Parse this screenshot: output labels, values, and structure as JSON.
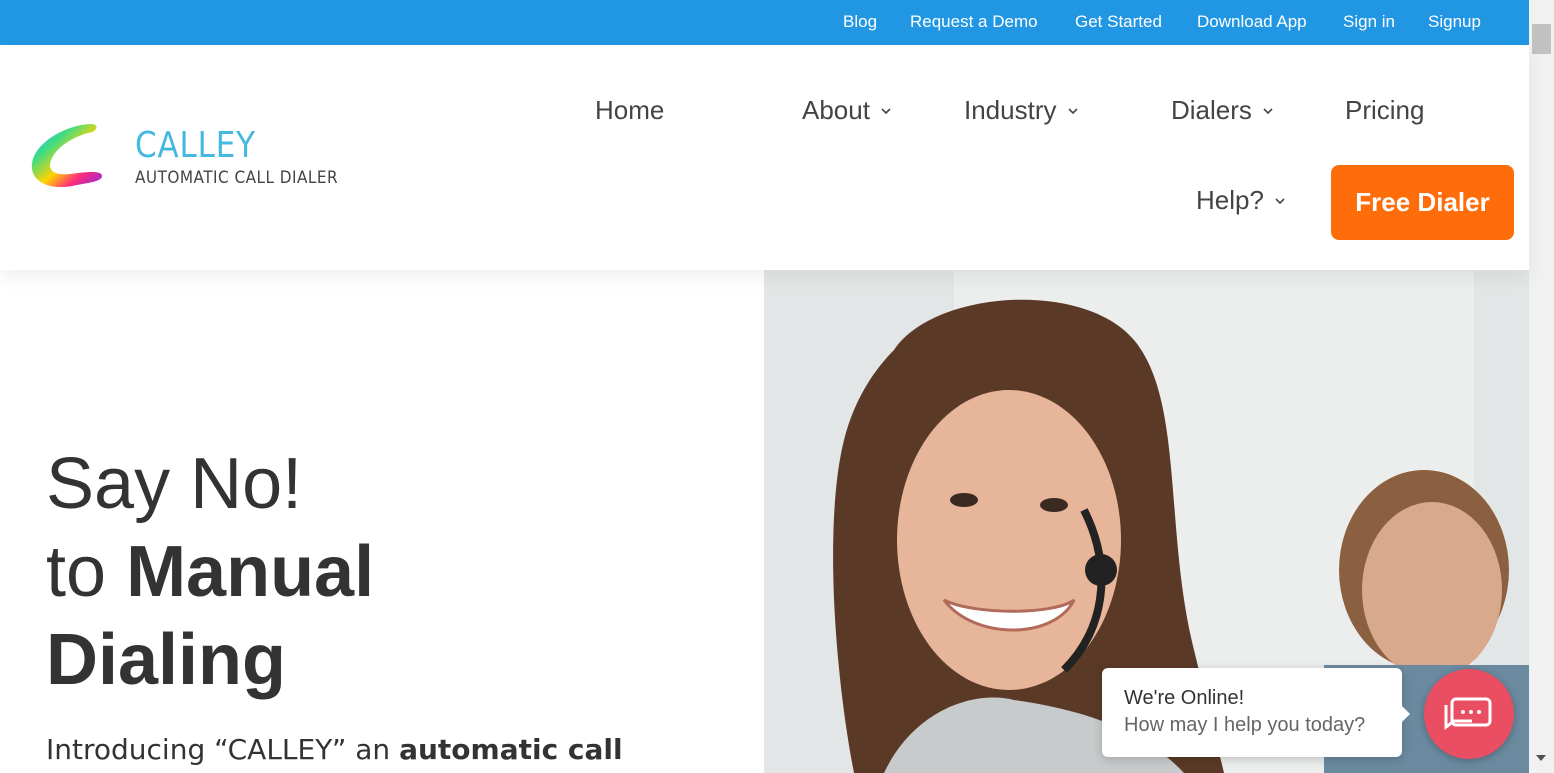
{
  "topbar": {
    "links": [
      "Blog",
      "Request a Demo",
      "Get Started",
      "Download App",
      "Sign in",
      "Signup"
    ]
  },
  "logo": {
    "name": "CALLEY",
    "tagline": "AUTOMATIC CALL DIALER"
  },
  "nav": {
    "home": "Home",
    "about": "About",
    "industry": "Industry",
    "dialers": "Dialers",
    "pricing": "Pricing",
    "help": "Help?",
    "cta": "Free Dialer"
  },
  "hero": {
    "line1": "Say No!",
    "line2_prefix": "to",
    "line2_bold": "Manual",
    "line3_bold": "Dialing",
    "intro_prefix": "Introducing “CALLEY” an",
    "intro_bold": "automatic call"
  },
  "chat": {
    "title": "We're Online!",
    "subtitle": "How may I help you today?"
  },
  "colors": {
    "topbar": "#2196e3",
    "cta": "#ff6c0a",
    "chat_button": "#e94e62",
    "logo_text": "#45b8e0"
  }
}
